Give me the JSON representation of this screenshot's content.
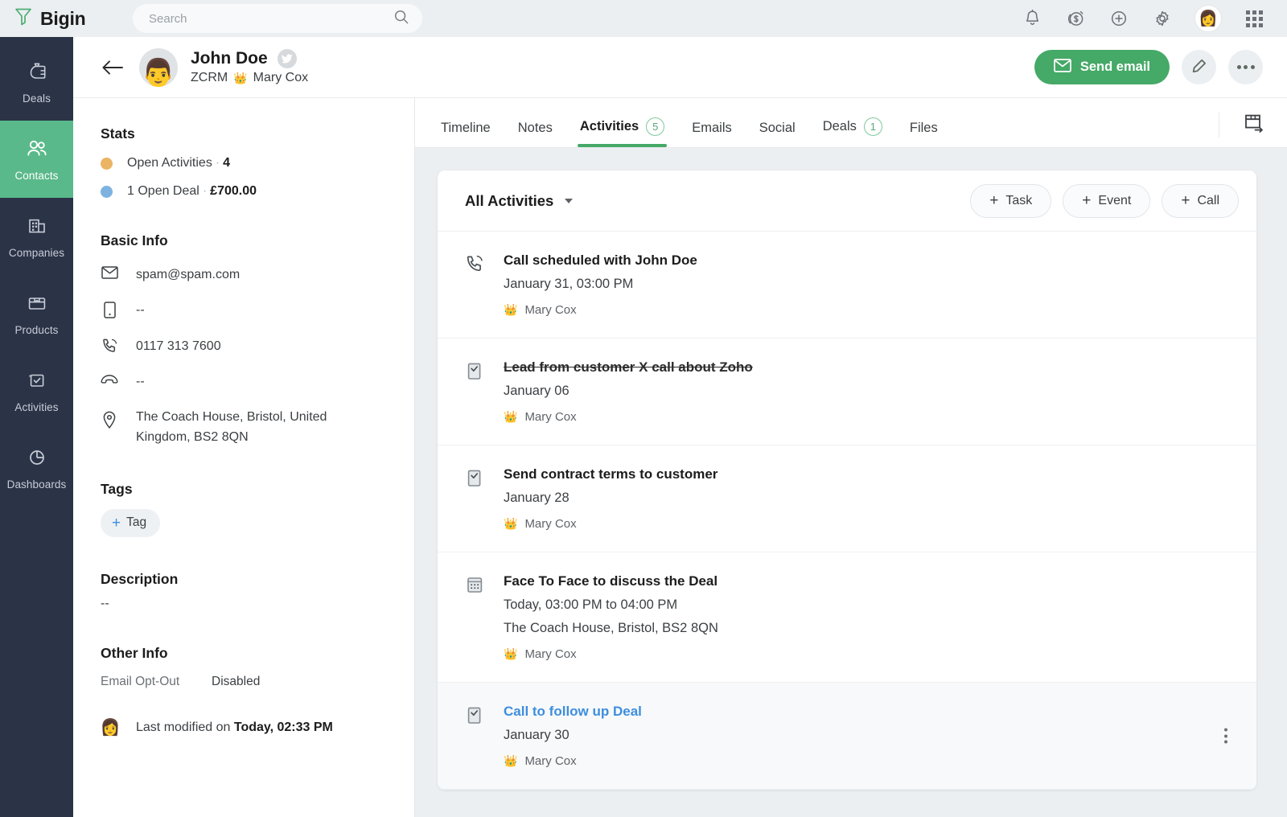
{
  "app": {
    "brand_name": "Bigin",
    "brand_icon": "funnel-icon"
  },
  "search": {
    "placeholder": "Search",
    "value": "",
    "icon": "search-icon"
  },
  "topbar_icons": [
    {
      "name": "notifications-icon",
      "glyph": "bell"
    },
    {
      "name": "revenue-icon",
      "glyph": "dollar-coin"
    },
    {
      "name": "add-icon",
      "glyph": "plus-circle"
    },
    {
      "name": "settings-icon",
      "glyph": "gear"
    },
    {
      "name": "user-avatar",
      "glyph": "avatar"
    },
    {
      "name": "apps-grid-icon",
      "glyph": "grid"
    }
  ],
  "sidebar": {
    "items": [
      {
        "label": "Deals",
        "icon": "money-bag-icon",
        "active": false
      },
      {
        "label": "Contacts",
        "icon": "contacts-icon",
        "active": true
      },
      {
        "label": "Companies",
        "icon": "building-icon",
        "active": false
      },
      {
        "label": "Products",
        "icon": "box-icon",
        "active": false
      },
      {
        "label": "Activities",
        "icon": "checklist-icon",
        "active": false
      },
      {
        "label": "Dashboards",
        "icon": "pie-chart-icon",
        "active": false
      }
    ],
    "active_color": "#5ab98a",
    "background": "#2b3347"
  },
  "record_header": {
    "back_icon": "back-arrow-icon",
    "avatar_icon": "contact-photo",
    "name": "John Doe",
    "social_badge": "twitter-icon",
    "source": "ZCRM",
    "owner": "Mary Cox",
    "owner_icon": "crown-icon",
    "send_email_label": "Send email",
    "send_email_icon": "envelope-icon",
    "edit_icon": "pencil-icon",
    "more_icon": "more-horizontal-icon",
    "accent_color": "#45a967"
  },
  "detail_panel": {
    "stats": {
      "title": "Stats",
      "rows": [
        {
          "label": "Open Activities",
          "value": "4",
          "color": "#eab464"
        },
        {
          "label": "1 Open Deal",
          "value": "£700.00",
          "color": "#7eb3e0"
        }
      ]
    },
    "basic_info": {
      "title": "Basic Info",
      "rows": [
        {
          "icon": "email-icon",
          "value": "spam@spam.com"
        },
        {
          "icon": "mobile-icon",
          "value": "--"
        },
        {
          "icon": "phone-icon",
          "value": "0117 313 7600"
        },
        {
          "icon": "telephone-icon",
          "value": "--"
        },
        {
          "icon": "location-icon",
          "value": "The Coach House, Bristol, United Kingdom, BS2 8QN"
        }
      ]
    },
    "tags": {
      "title": "Tags",
      "add_label": "Tag",
      "add_icon": "plus-icon"
    },
    "description": {
      "title": "Description",
      "value": "--"
    },
    "other_info": {
      "title": "Other Info",
      "key": "Email Opt-Out",
      "value": "Disabled"
    },
    "last_modified": {
      "prefix": "Last modified on ",
      "timestamp": "Today, 02:33 PM",
      "icon": "user-avatar-small"
    }
  },
  "tabs": [
    {
      "label": "Timeline",
      "badge": "",
      "active": false
    },
    {
      "label": "Notes",
      "badge": "",
      "active": false
    },
    {
      "label": "Activities",
      "badge": "5",
      "active": true
    },
    {
      "label": "Emails",
      "badge": "",
      "active": false
    },
    {
      "label": "Social",
      "badge": "",
      "active": false
    },
    {
      "label": "Deals",
      "badge": "1",
      "active": false
    },
    {
      "label": "Files",
      "badge": "",
      "active": false
    }
  ],
  "panel_toggle_icon": "collapse-panel-icon",
  "activities": {
    "filter_label": "All Activities",
    "filter_caret": "chevron-down-icon",
    "add_buttons": [
      {
        "label": "Task",
        "icon": "plus-icon"
      },
      {
        "label": "Event",
        "icon": "plus-icon"
      },
      {
        "label": "Call",
        "icon": "plus-icon"
      }
    ],
    "rows": [
      {
        "icon": "call-icon",
        "title": "Call scheduled with John Doe",
        "completed": false,
        "highlighted": false,
        "meta": "January 31, 03:00 PM",
        "location": "",
        "owner": "Mary Cox",
        "owner_icon": "crown-icon",
        "hovered": false
      },
      {
        "icon": "task-icon",
        "title": "Lead from customer X call about Zoho",
        "completed": true,
        "highlighted": false,
        "meta": "January 06",
        "location": "",
        "owner": "Mary Cox",
        "owner_icon": "crown-icon",
        "hovered": false
      },
      {
        "icon": "task-icon",
        "title": "Send contract terms to customer",
        "completed": false,
        "highlighted": false,
        "meta": "January 28",
        "location": "",
        "owner": "Mary Cox",
        "owner_icon": "crown-icon",
        "hovered": false
      },
      {
        "icon": "event-icon",
        "title": "Face To Face to discuss the Deal",
        "completed": false,
        "highlighted": false,
        "meta": "Today, 03:00 PM to 04:00 PM",
        "location": "The Coach House, Bristol, BS2 8QN",
        "owner": "Mary Cox",
        "owner_icon": "crown-icon",
        "hovered": false
      },
      {
        "icon": "task-icon",
        "title": "Call to follow up Deal",
        "completed": false,
        "highlighted": true,
        "meta": "January 30",
        "location": "",
        "owner": "Mary Cox",
        "owner_icon": "crown-icon",
        "hovered": true,
        "menu_icon": "more-vertical-icon"
      }
    ]
  }
}
